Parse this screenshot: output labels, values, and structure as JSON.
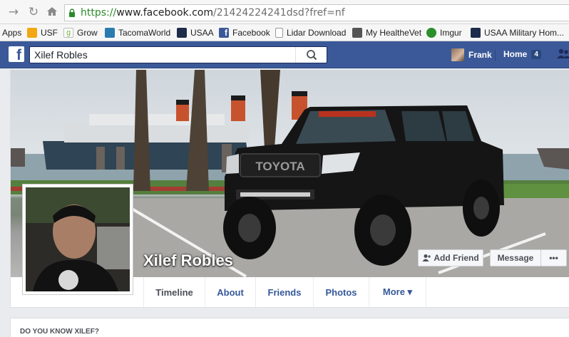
{
  "browser": {
    "url_scheme": "https://",
    "url_host": "www.facebook.com",
    "url_path": "/21424224241dsd?fref=nf"
  },
  "bookmarks": [
    {
      "label": "Apps",
      "icon": "apps-grid-icon",
      "color": "#4285f4"
    },
    {
      "label": "USF",
      "icon": "usf-icon",
      "color": "#f3a712"
    },
    {
      "label": "Grow",
      "icon": "grow-leaf-icon",
      "color": "#6fb63c"
    },
    {
      "label": "TacomaWorld",
      "icon": "tacomaworld-icon",
      "color": "#2a7ab0"
    },
    {
      "label": "USAA",
      "icon": "usaa-eagle-icon",
      "color": "#1d2c4a"
    },
    {
      "label": "Facebook",
      "icon": "facebook-icon",
      "color": "#3b5998"
    },
    {
      "label": "Lidar Download",
      "icon": "page-icon",
      "color": "#9a9a9a"
    },
    {
      "label": "My HealtheVet",
      "icon": "healthevet-icon",
      "color": "#555555"
    },
    {
      "label": "Imgur",
      "icon": "imgur-icon",
      "color": "#2c8f2c"
    },
    {
      "label": "USAA Military Hom...",
      "icon": "usaa-eagle-icon",
      "color": "#1d2c4a"
    }
  ],
  "fb": {
    "search_value": "Xilef Robles",
    "user_name": "Frank",
    "home_label": "Home",
    "home_count": "4",
    "brand_color": "#3b5998"
  },
  "profile": {
    "name": "Xilef Robles",
    "add_friend_label": "Add Friend",
    "message_label": "Message",
    "more_label": "•••",
    "cover_plate": "TOYOTA"
  },
  "tabs": [
    {
      "label": "Timeline"
    },
    {
      "label": "About"
    },
    {
      "label": "Friends"
    },
    {
      "label": "Photos"
    },
    {
      "label": "More ▾"
    }
  ],
  "know_heading": "DO YOU KNOW XILEF?"
}
